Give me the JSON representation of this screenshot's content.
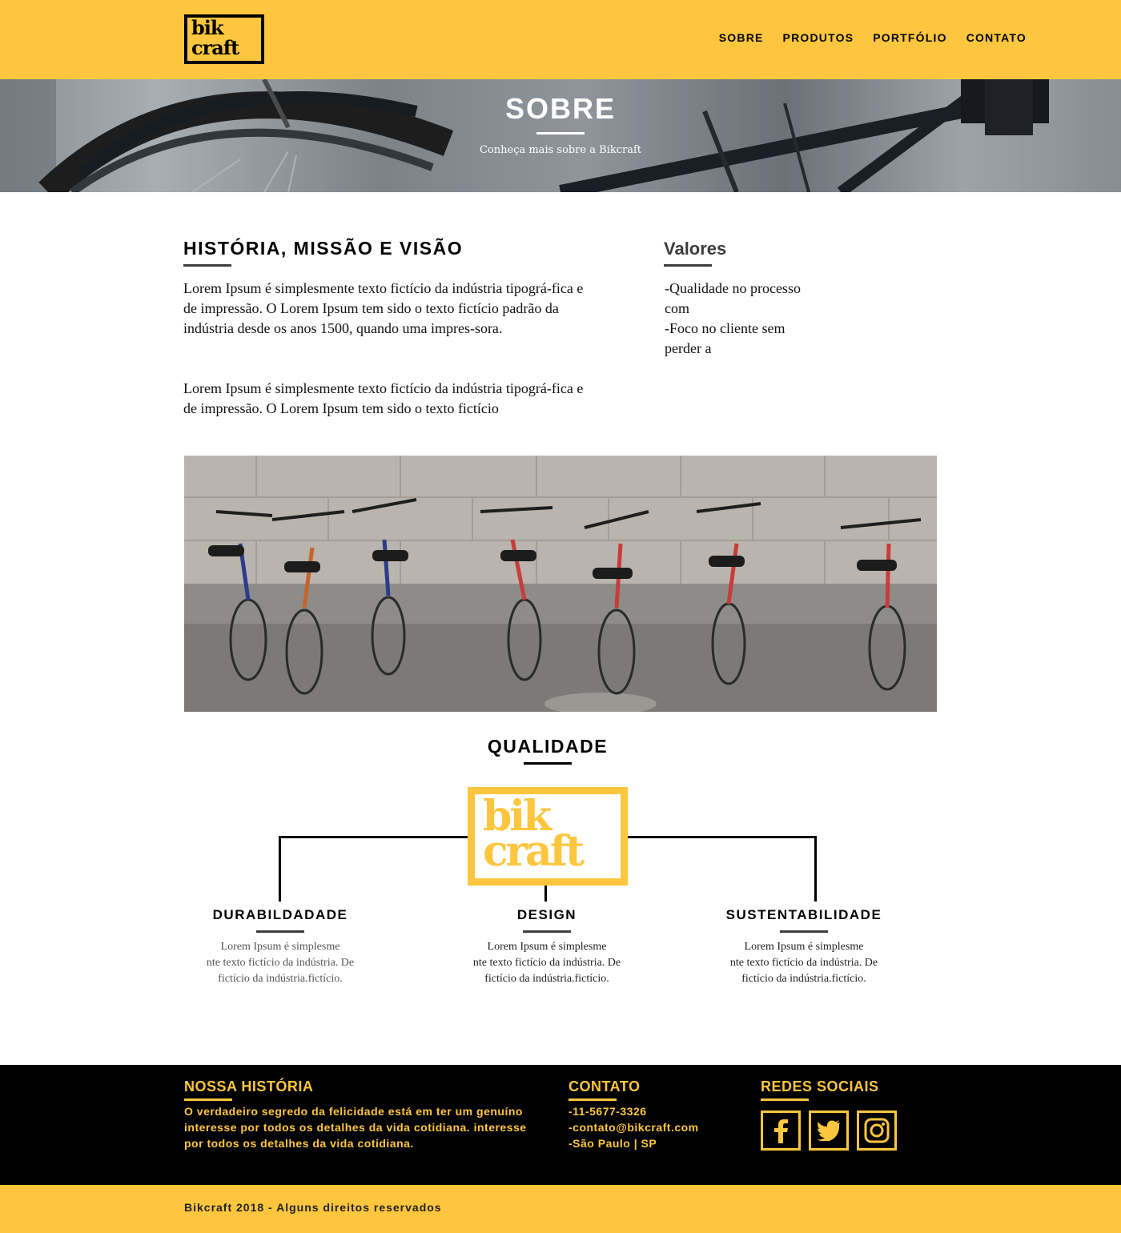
{
  "brand": {
    "logo_line1": "bik",
    "logo_line2": "craft",
    "primary_color": "#fec63e",
    "dark_color": "#000000"
  },
  "nav": {
    "items": [
      "SOBRE",
      "PRODUTOS",
      "PORTFÓLIO",
      "CONTATO"
    ]
  },
  "hero": {
    "title": "SOBRE",
    "subtitle": "Conheça mais sobre a Bikcraft"
  },
  "intro": {
    "title": "HISTÓRIA, MISSÃO E VISÃO",
    "paragraph1": "Lorem Ipsum é simplesmente texto fictício da indústria tipográ-fica e de impressão. O Lorem Ipsum tem sido o texto fictício padrão da indústria desde os anos 1500, quando uma impres-sora.",
    "paragraph2": "Lorem Ipsum é simplesmente texto fictício da indústria tipográ-fica e de impressão. O Lorem Ipsum tem sido o texto fictício"
  },
  "values": {
    "title": "Valores",
    "items": [
      "-Qualidade no processo\ncom",
      "-Foco no cliente sem\nperder a"
    ]
  },
  "quality": {
    "title": "QUALIDADE",
    "items": [
      {
        "title": "DURABILDADADE",
        "text": "Lorem Ipsum é simplesme\nnte texto fictício da indústria. De\nfictício da indústria.fictício."
      },
      {
        "title": "DESIGN",
        "text": "Lorem Ipsum é simplesme\nnte texto fictício da indústria. De\nfictício da indústria.fictício."
      },
      {
        "title": "SUSTENTABILIDADE",
        "text": "Lorem Ipsum é simplesme\nnte texto fictício da indústria. De\nfictício da indústria.fictício."
      }
    ]
  },
  "footer": {
    "history_title": "NOSSA HISTÓRIA",
    "history_text": "O verdadeiro segredo da felicidade está em ter um genuíno interesse por todos os detalhes da vida cotidiana. interesse por todos os detalhes da vida cotidiana.",
    "contact_title": "CONTATO",
    "phone": "-11-5677-3326",
    "email": "-contato@bikcraft.com",
    "location": "-São Paulo | SP",
    "social_title": "REDES SOCIAIS",
    "social_icons": [
      "facebook-icon",
      "twitter-icon",
      "instagram-icon"
    ],
    "copyright": "Bikcraft 2018 - Alguns direitos reservados"
  }
}
